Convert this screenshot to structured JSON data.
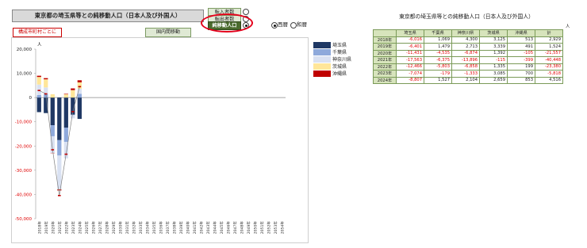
{
  "title": "東京都の埼玉県等との純移動人口（日本人及び外国人）",
  "options": [
    {
      "label": "転入者数",
      "selected": false
    },
    {
      "label": "転出者数",
      "selected": false
    },
    {
      "label": "純移動人口",
      "selected": true
    }
  ],
  "link_button": "構成市町村ごとに",
  "intl_button": "国内間移動",
  "era": {
    "western": "西暦",
    "japanese": "和暦",
    "selected": "western"
  },
  "colors": {
    "saitama": "#1f3864",
    "chiba": "#8ea9db",
    "kanagawa": "#d9e1f2",
    "ibaraki": "#ffe699",
    "okinawa": "#c00000",
    "total": "#7f7f7f",
    "neg": "#e00000",
    "highlight": "#e4001b"
  },
  "chart_data": {
    "type": "bar",
    "stacked": true,
    "unit_label": "人",
    "ylim": [
      -50000,
      20000
    ],
    "yticks": [
      "20,000",
      "10,000",
      "0",
      "-10,000",
      "-20,000",
      "-30,000",
      "-40,000",
      "-50,000"
    ],
    "categories": [
      "2018年",
      "2019年",
      "2020年",
      "2021年",
      "2022年",
      "2023年",
      "2024年",
      "2025年",
      "2026年",
      "2027年",
      "2028年",
      "2029年",
      "2030年",
      "2031年",
      "2032年",
      "2033年",
      "2034年",
      "2035年",
      "2036年",
      "2037年",
      "2038年",
      "2039年",
      "2040年",
      "2041年",
      "2042年",
      "2043年",
      "2044年",
      "2045年",
      "2046年",
      "2047年",
      "2048年",
      "2049年",
      "2050年",
      "2051年",
      "2052年",
      "2053年",
      "2054年"
    ],
    "series": [
      {
        "name": "埼玉県",
        "values": [
          -6016,
          -6401,
          -11431,
          -17563,
          -12466,
          -7074,
          -8807
        ]
      },
      {
        "name": "千葉県",
        "values": [
          1069,
          1479,
          -4535,
          -6375,
          -5803,
          -179,
          1527
        ]
      },
      {
        "name": "神奈川県",
        "values": [
          4300,
          2713,
          -6874,
          -13896,
          -6858,
          -1333,
          2104
        ]
      },
      {
        "name": "茨城県",
        "values": [
          3125,
          3339,
          1392,
          -115,
          1335,
          3085,
          2659
        ]
      },
      {
        "name": "沖縄県",
        "values": [
          513,
          491,
          -105,
          -399,
          199,
          700,
          853
        ]
      }
    ],
    "total": {
      "name": "計",
      "values": [
        2929,
        1524,
        -21557,
        -40448,
        -23380,
        -5818,
        4516
      ]
    },
    "legend_position": "right"
  },
  "table": {
    "title": "東京都の埼玉県等との純移動人口（日本人及び外国人）",
    "unit": "人",
    "headers": [
      "",
      "埼玉県",
      "千葉県",
      "神奈川県",
      "茨城県",
      "沖縄県",
      "計"
    ],
    "rows": [
      [
        "2018年",
        "-6,016",
        "1,069",
        "4,300",
        "3,125",
        "513",
        "2,929"
      ],
      [
        "2019年",
        "-6,401",
        "1,479",
        "2,713",
        "3,339",
        "491",
        "1,524"
      ],
      [
        "2020年",
        "-11,431",
        "-4,535",
        "-6,874",
        "1,392",
        "-105",
        "-21,557"
      ],
      [
        "2021年",
        "-17,563",
        "-6,375",
        "-13,896",
        "-115",
        "-399",
        "-40,448"
      ],
      [
        "2022年",
        "-12,466",
        "-5,803",
        "-6,858",
        "1,335",
        "199",
        "-23,380"
      ],
      [
        "2023年",
        "-7,074",
        "-179",
        "-1,333",
        "3,085",
        "700",
        "-5,818"
      ],
      [
        "2024年",
        "-8,807",
        "1,527",
        "2,104",
        "2,659",
        "853",
        "4,516"
      ]
    ]
  }
}
